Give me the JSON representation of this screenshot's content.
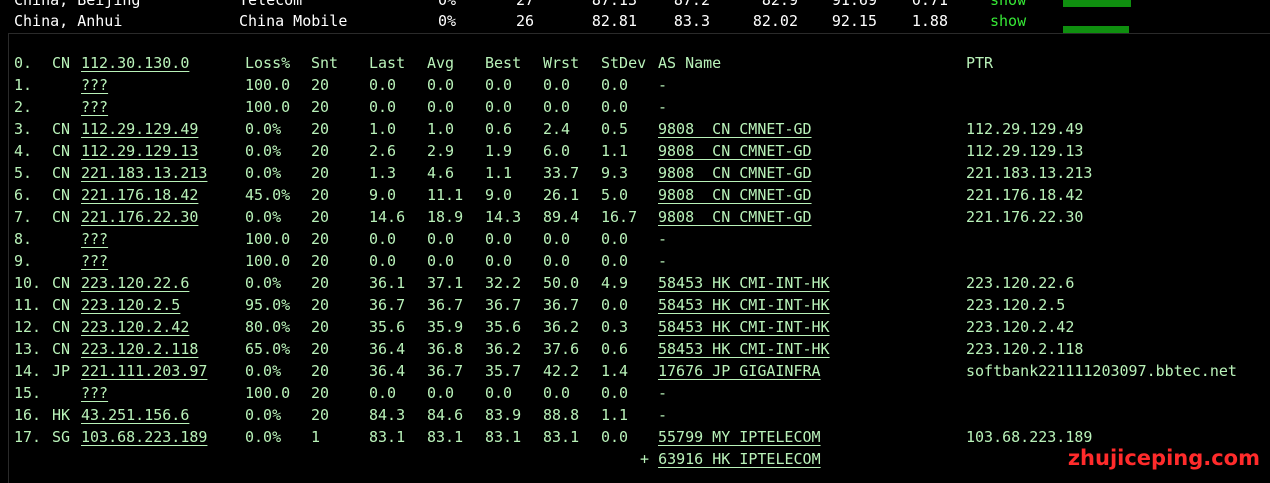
{
  "summary": {
    "partial_row": {
      "location": "China, Beijing",
      "isp": "Telecom",
      "loss": "0%",
      "snt": "27",
      "last": "87.13",
      "avg": "87.2",
      "best": "82.9",
      "wrst": "91.69",
      "stdev": "0.71",
      "action": "show"
    },
    "row": {
      "location": "China, Anhui",
      "isp": "China Mobile",
      "loss": "0%",
      "snt": "26",
      "last": "82.81",
      "avg": "83.3",
      "best": "82.02",
      "wrst": "92.15",
      "stdev": "1.88",
      "action": "show"
    }
  },
  "mtr": {
    "header": {
      "hop": "0.",
      "cc": "CN",
      "host": "112.30.130.0",
      "loss": "Loss%",
      "snt": "Snt",
      "last": "Last",
      "avg": "Avg",
      "best": "Best",
      "wrst": "Wrst",
      "stdev": "StDev",
      "asname": "AS Name",
      "ptr": "PTR"
    },
    "rows": [
      {
        "hop": "1.",
        "cc": "",
        "host": "???",
        "loss": "100.0",
        "snt": "20",
        "last": "0.0",
        "avg": "0.0",
        "best": "0.0",
        "wrst": "0.0",
        "stdev": "0.0",
        "asname": "-",
        "ptr": ""
      },
      {
        "hop": "2.",
        "cc": "",
        "host": "???",
        "loss": "100.0",
        "snt": "20",
        "last": "0.0",
        "avg": "0.0",
        "best": "0.0",
        "wrst": "0.0",
        "stdev": "0.0",
        "asname": "-",
        "ptr": ""
      },
      {
        "hop": "3.",
        "cc": "CN",
        "host": "112.29.129.49",
        "loss": "0.0%",
        "snt": "20",
        "last": "1.0",
        "avg": "1.0",
        "best": "0.6",
        "wrst": "2.4",
        "stdev": "0.5",
        "asname": "9808  CN CMNET-GD",
        "ptr": "112.29.129.49"
      },
      {
        "hop": "4.",
        "cc": "CN",
        "host": "112.29.129.13",
        "loss": "0.0%",
        "snt": "20",
        "last": "2.6",
        "avg": "2.9",
        "best": "1.9",
        "wrst": "6.0",
        "stdev": "1.1",
        "asname": "9808  CN CMNET-GD",
        "ptr": "112.29.129.13"
      },
      {
        "hop": "5.",
        "cc": "CN",
        "host": "221.183.13.213",
        "loss": "0.0%",
        "snt": "20",
        "last": "1.3",
        "avg": "4.6",
        "best": "1.1",
        "wrst": "33.7",
        "stdev": "9.3",
        "asname": "9808  CN CMNET-GD",
        "ptr": "221.183.13.213"
      },
      {
        "hop": "6.",
        "cc": "CN",
        "host": "221.176.18.42",
        "loss": "45.0%",
        "snt": "20",
        "last": "9.0",
        "avg": "11.1",
        "best": "9.0",
        "wrst": "26.1",
        "stdev": "5.0",
        "asname": "9808  CN CMNET-GD",
        "ptr": "221.176.18.42"
      },
      {
        "hop": "7.",
        "cc": "CN",
        "host": "221.176.22.30",
        "loss": "0.0%",
        "snt": "20",
        "last": "14.6",
        "avg": "18.9",
        "best": "14.3",
        "wrst": "89.4",
        "stdev": "16.7",
        "asname": "9808  CN CMNET-GD",
        "ptr": "221.176.22.30"
      },
      {
        "hop": "8.",
        "cc": "",
        "host": "???",
        "loss": "100.0",
        "snt": "20",
        "last": "0.0",
        "avg": "0.0",
        "best": "0.0",
        "wrst": "0.0",
        "stdev": "0.0",
        "asname": "-",
        "ptr": ""
      },
      {
        "hop": "9.",
        "cc": "",
        "host": "???",
        "loss": "100.0",
        "snt": "20",
        "last": "0.0",
        "avg": "0.0",
        "best": "0.0",
        "wrst": "0.0",
        "stdev": "0.0",
        "asname": "-",
        "ptr": ""
      },
      {
        "hop": "10.",
        "cc": "CN",
        "host": "223.120.22.6",
        "loss": "0.0%",
        "snt": "20",
        "last": "36.1",
        "avg": "37.1",
        "best": "32.2",
        "wrst": "50.0",
        "stdev": "4.9",
        "asname": "58453 HK CMI-INT-HK",
        "ptr": "223.120.22.6"
      },
      {
        "hop": "11.",
        "cc": "CN",
        "host": "223.120.2.5",
        "loss": "95.0%",
        "snt": "20",
        "last": "36.7",
        "avg": "36.7",
        "best": "36.7",
        "wrst": "36.7",
        "stdev": "0.0",
        "asname": "58453 HK CMI-INT-HK",
        "ptr": "223.120.2.5"
      },
      {
        "hop": "12.",
        "cc": "CN",
        "host": "223.120.2.42",
        "loss": "80.0%",
        "snt": "20",
        "last": "35.6",
        "avg": "35.9",
        "best": "35.6",
        "wrst": "36.2",
        "stdev": "0.3",
        "asname": "58453 HK CMI-INT-HK",
        "ptr": "223.120.2.42"
      },
      {
        "hop": "13.",
        "cc": "CN",
        "host": "223.120.2.118",
        "loss": "65.0%",
        "snt": "20",
        "last": "36.4",
        "avg": "36.8",
        "best": "36.2",
        "wrst": "37.6",
        "stdev": "0.6",
        "asname": "58453 HK CMI-INT-HK",
        "ptr": "223.120.2.118"
      },
      {
        "hop": "14.",
        "cc": "JP",
        "host": "221.111.203.97",
        "loss": "0.0%",
        "snt": "20",
        "last": "36.4",
        "avg": "36.7",
        "best": "35.7",
        "wrst": "42.2",
        "stdev": "1.4",
        "asname": "17676 JP GIGAINFRA",
        "ptr": "softbank221111203097.bbtec.net"
      },
      {
        "hop": "15.",
        "cc": "",
        "host": "???",
        "loss": "100.0",
        "snt": "20",
        "last": "0.0",
        "avg": "0.0",
        "best": "0.0",
        "wrst": "0.0",
        "stdev": "0.0",
        "asname": "-",
        "ptr": ""
      },
      {
        "hop": "16.",
        "cc": "HK",
        "host": "43.251.156.6",
        "loss": "0.0%",
        "snt": "20",
        "last": "84.3",
        "avg": "84.6",
        "best": "83.9",
        "wrst": "88.8",
        "stdev": "1.1",
        "asname": "-",
        "ptr": ""
      },
      {
        "hop": "17.",
        "cc": "SG",
        "host": "103.68.223.189",
        "loss": "0.0%",
        "snt": "1",
        "last": "83.1",
        "avg": "83.1",
        "best": "83.1",
        "wrst": "83.1",
        "stdev": "0.0",
        "asname": "55799 MY IPTELECOM",
        "ptr": "103.68.223.189"
      },
      {
        "hop": "",
        "cc": "",
        "host": "",
        "loss": "",
        "snt": "",
        "last": "",
        "avg": "",
        "best": "",
        "wrst": "",
        "stdev": "",
        "asname": "+ 63916 HK IPTELECOM",
        "ptr": ""
      }
    ]
  },
  "watermark": "zhujiceping.com",
  "colors": {
    "background": "#000000",
    "terminal_text": "#b9f2b9",
    "link_green": "#36e836",
    "watermark": "#ff2b2b"
  }
}
